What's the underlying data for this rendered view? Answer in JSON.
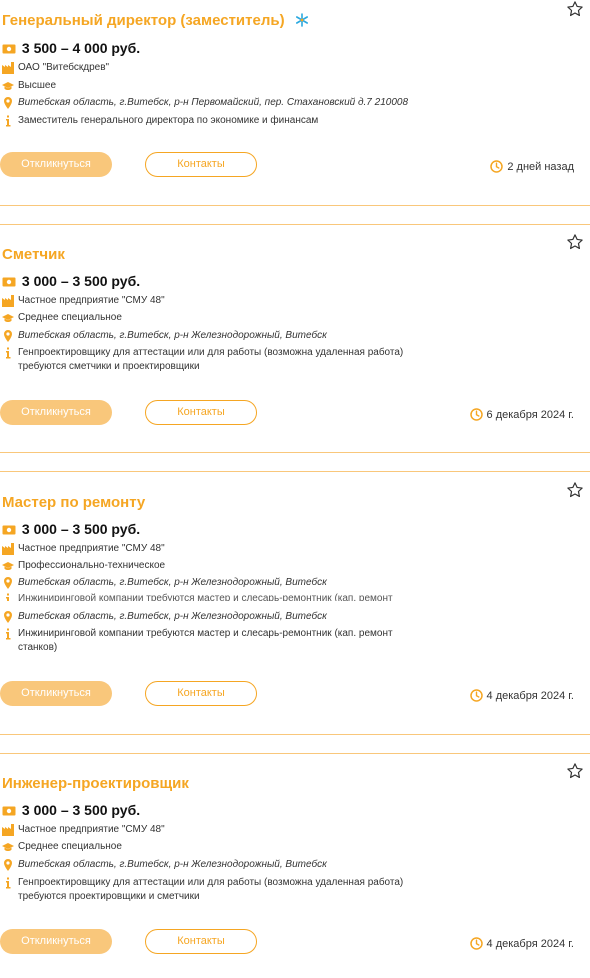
{
  "colors": {
    "accent": "#f5a623",
    "button_fill": "#f9c77b",
    "salary_text": "#111111"
  },
  "vacancies": [
    {
      "title": "Генеральный директор (заместитель)",
      "salary": "3 500 – 4 000 руб.",
      "company": "ОАО \"Витебскдрев\"",
      "education": "Высшее",
      "address": "Витебская область, г.Витебск, р-н Первомайский, пер. Стахановский д.7 210008",
      "description": "Заместитель генерального директора по экономике и финансам",
      "apply_label": "Откликнуться",
      "contacts_label": "Контакты",
      "date": "2 дней назад"
    },
    {
      "title": "Сметчик",
      "salary": "3 000 – 3 500 руб.",
      "company": "Частное предприятие \"СМУ 48\"",
      "education": "Среднее специальное",
      "address": "Витебская область, г.Витебск, р-н Железнодорожный, Витебск",
      "description": "Генпроектировщику для аттестации или для работы (возможна удаленная работа) требуются сметчики и проектировщики",
      "apply_label": "Откликнуться",
      "contacts_label": "Контакты",
      "date": "6 декабря 2024 г."
    },
    {
      "title": "Мастер по ремонту",
      "salary": "3 000 – 3 500 руб.",
      "company": "Частное предприятие \"СМУ 48\"",
      "education": "Профессионально-техническое",
      "address": "Витебская область, г.Витебск, р-н Железнодорожный, Витебск",
      "overlap_text": "Инжиниринговой компании требуются мастер и слесарь-ремонтник (кап. ремонт",
      "address_repeat": "Витебская область, г.Витебск, р-н Железнодорожный, Витебск",
      "description": "Инжиниринговой компании требуются мастер и слесарь-ремонтник (кап. ремонт станков)",
      "apply_label": "Откликнуться",
      "contacts_label": "Контакты",
      "date": "4 декабря 2024 г."
    },
    {
      "title": "Инженер-проектировщик",
      "salary": "3 000 – 3 500 руб.",
      "company": "Частное предприятие \"СМУ 48\"",
      "education": "Среднее специальное",
      "address": "Витебская область, г.Витебск, р-н Железнодорожный, Витебск",
      "description": "Генпроектировщику для аттестации или для работы (возможна удаленная работа) требуются проектировщики и сметчики",
      "apply_label": "Откликнуться",
      "contacts_label": "Контакты",
      "date": "4 декабря 2024 г."
    }
  ]
}
